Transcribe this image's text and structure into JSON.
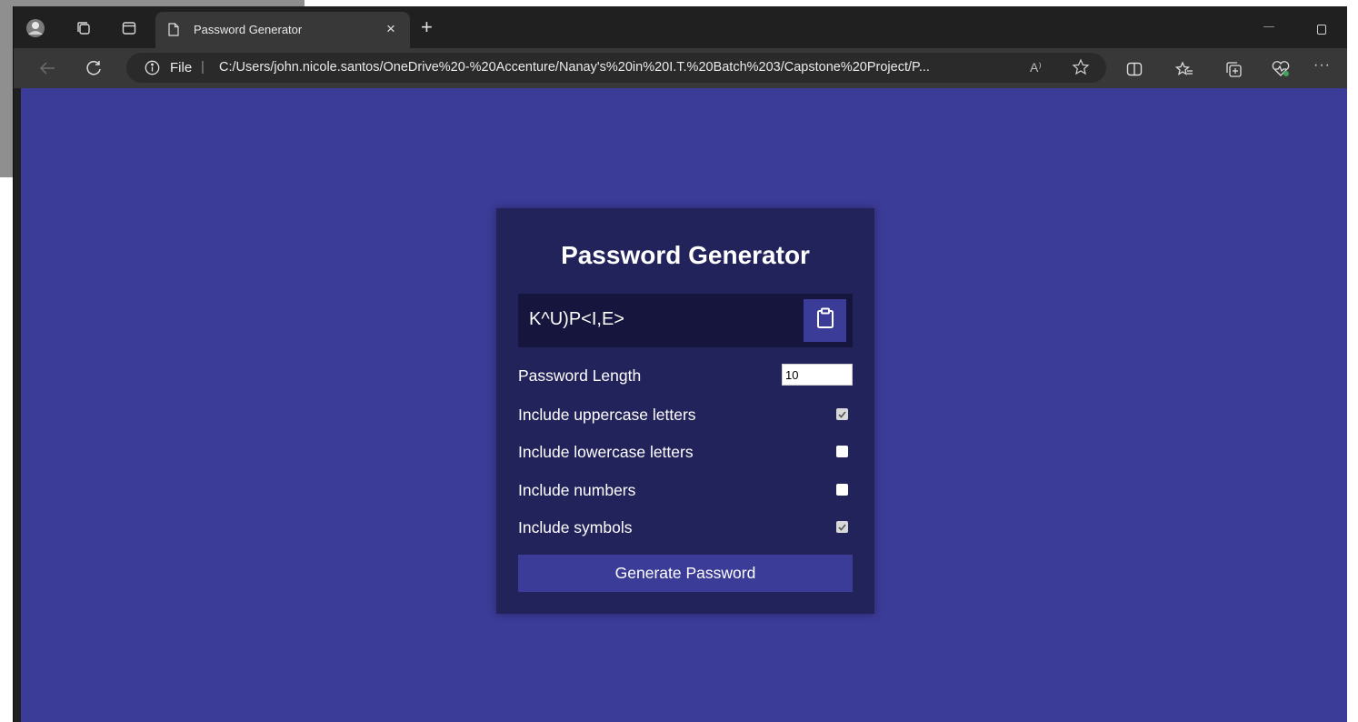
{
  "browser": {
    "tab": {
      "title": "Password Generator"
    },
    "new_tab_label": "+",
    "close_label": "×",
    "address": {
      "scheme_label": "File",
      "separator": "|",
      "url": "C:/Users/john.nicole.santos/OneDrive%20-%20Accenture/Nanay's%20in%20I.T.%20Batch%203/Capstone%20Project/P...",
      "read_aloud_label": "A⁾"
    },
    "more_label": "···"
  },
  "app": {
    "title": "Password Generator",
    "result": "K^U)P<I,E>",
    "length_label": "Password Length",
    "length_value": "10",
    "options": [
      {
        "label": "Include uppercase letters",
        "checked": true
      },
      {
        "label": "Include lowercase letters",
        "checked": false
      },
      {
        "label": "Include numbers",
        "checked": false
      },
      {
        "label": "Include symbols",
        "checked": true
      }
    ],
    "generate_label": "Generate Password"
  },
  "colors": {
    "page_bg": "#3b3b98",
    "card_bg": "#23235b",
    "result_bg": "#15153d",
    "accent": "#3b3b98"
  },
  "icons": {
    "profile": "profile-avatar-icon",
    "workspaces": "workspaces-icon",
    "tab_actions": "tab-actions-icon",
    "tab_page": "document-icon",
    "back": "back-arrow-icon",
    "refresh": "refresh-icon",
    "info": "info-icon",
    "favorite": "star-icon",
    "split": "split-screen-icon",
    "favorites": "favorites-icon",
    "collections": "collections-icon",
    "health": "browser-essentials-icon",
    "clipboard": "clipboard-icon"
  }
}
